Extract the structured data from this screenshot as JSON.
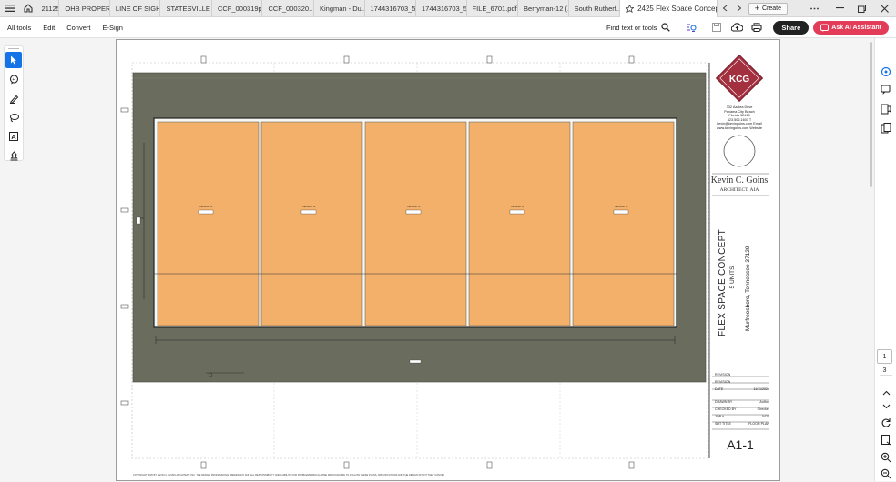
{
  "tabs": [
    "21125...",
    "OHB PROPER...",
    "LINE OF SIGH...",
    "STATESVILLE ...",
    "CCF_000319p...",
    "CCF_000320...",
    "Kingman - Du...",
    "1744316703_5...",
    "1744316703_5...",
    "FILE_6701.pdf",
    "Berryman-12 (...",
    "South Rutherf...",
    "2425 Flex Space Concep..."
  ],
  "create_label": "Create",
  "menu": {
    "all_tools": "All tools",
    "edit": "Edit",
    "convert": "Convert",
    "esign": "E-Sign",
    "find": "Find text or tools",
    "share": "Share",
    "ask_ai": "Ask AI Assistant"
  },
  "titleblock": {
    "logo": "KCG",
    "address": [
      "332 Azalea Drive",
      "Panama City Beach",
      "Florida 32413",
      "423.506.1601 T",
      "kevin@kevingoins.com Email",
      "www.kevingoins.com Website"
    ],
    "architect_name": "Kevin C. Goins",
    "architect_title": "ARCHITECT, AIA",
    "project": "FLEX SPACE CONCEPT",
    "units": "5 UNITS",
    "location": "Murfreesboro, Tennessee 37129",
    "rows": [
      [
        "REVISION",
        ""
      ],
      [
        "REVISION",
        ""
      ],
      [
        "DATE",
        "11/11/2024"
      ],
      [
        "DRAWN BY",
        "Author"
      ],
      [
        "CHECKED BY",
        "Checker"
      ],
      [
        "JOB #",
        "0425"
      ],
      [
        "SHT TITLE",
        "FLOOR PLAN"
      ]
    ],
    "sheet": "A1-1"
  },
  "plan": {
    "tenants": [
      "TENANT A",
      "TENANT A",
      "TENANT A",
      "TENANT A",
      "TENANT A"
    ],
    "footer": "COPYRIGHT 2025 BY KEVIN C. GOINS ARCHITECT, INC. THE DESIGN PROFESSIONAL DENIES ANY AND ALL RESPONSIBILITY AND LIABILITY FOR PROBLEMS WHICH ARISE FROM FAILURE TO FOLLOW THESE PLANS, SPECIFICATIONS AND THE DESIGN INTENT THEY CONVEY"
  },
  "page": {
    "current": "1",
    "total": "3"
  },
  "colors": {
    "accent": "#1473e6",
    "ai": "#e23c59",
    "floor": "#f3b06b",
    "site": "#6a6d5e"
  }
}
